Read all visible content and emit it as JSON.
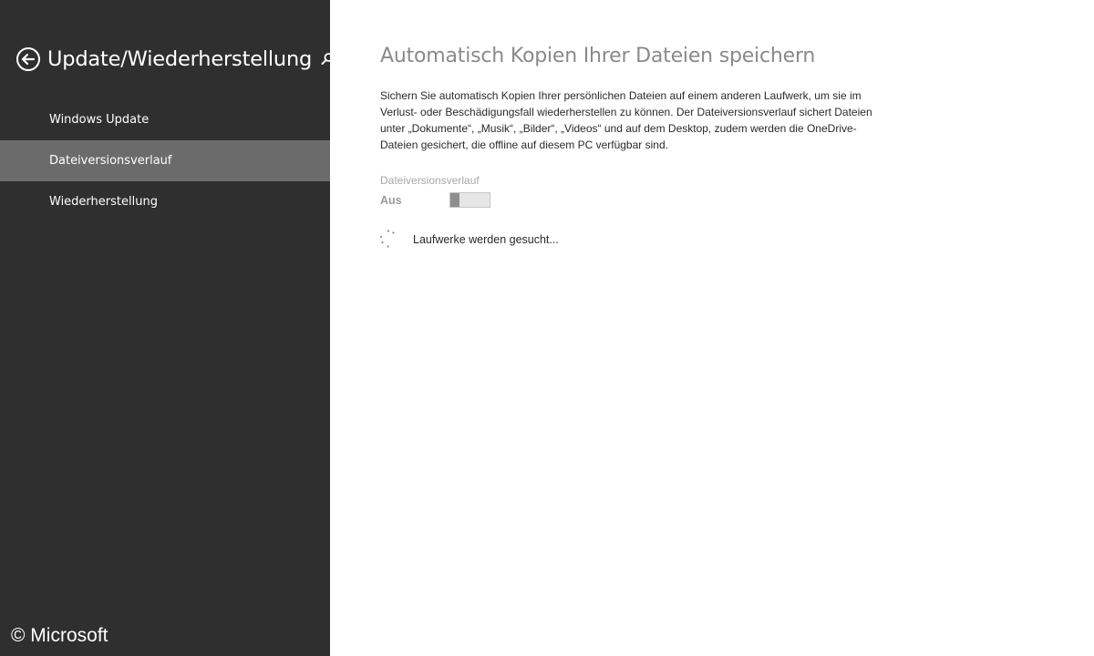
{
  "sidebar": {
    "title": "Update/Wiederherstellung",
    "back_icon": "back-arrow-circle-icon",
    "search_icon": "search-icon",
    "items": [
      {
        "label": "Windows Update",
        "selected": false
      },
      {
        "label": "Dateiversionsverlauf",
        "selected": true
      },
      {
        "label": "Wiederherstellung",
        "selected": false
      }
    ],
    "copyright": "© Microsoft"
  },
  "main": {
    "title": "Automatisch Kopien Ihrer Dateien speichern",
    "description": "Sichern Sie automatisch Kopien Ihrer persönlichen Dateien auf einem anderen Laufwerk, um sie im Verlust- oder Beschädigungsfall wiederherstellen zu können. Der Dateiversionsverlauf sichert Dateien unter „Dokumente“, „Musik“, „Bilder“, „Videos“ und auf dem Desktop, zudem werden die OneDrive-Dateien gesichert, die offline auf diesem PC verfügbar sind.",
    "setting": {
      "label": "Dateiversionsverlauf",
      "state": "Aus",
      "enabled": false
    },
    "status": {
      "icon": "loading-spinner-icon",
      "text": "Laufwerke werden gesucht..."
    }
  },
  "colors": {
    "sidebar_background": "#2f2f2f",
    "selected_item_background": "#6b6b6b",
    "main_background": "#ffffff",
    "title_text": "#8a8a8a"
  }
}
